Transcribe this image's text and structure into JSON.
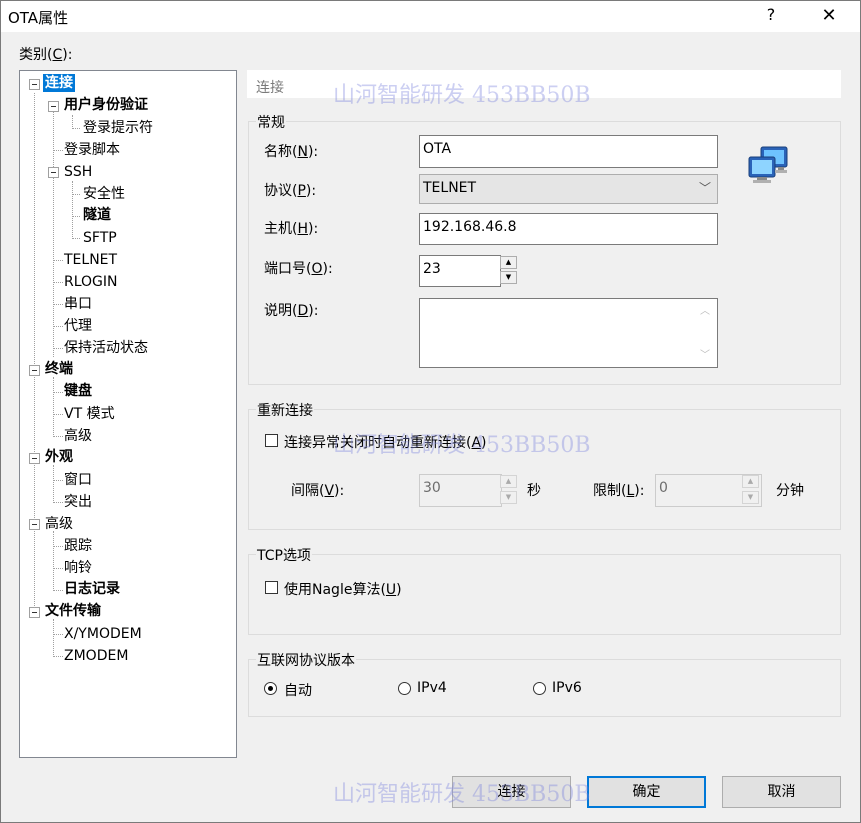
{
  "window": {
    "title": "OTA属性",
    "help": "?",
    "close": "✕"
  },
  "category_label": "类别(C):",
  "tree": [
    {
      "label": "连接",
      "selected": true
    },
    {
      "label": "用户身份验证"
    },
    {
      "label": "登录提示符"
    },
    {
      "label": "登录脚本"
    },
    {
      "label": "SSH"
    },
    {
      "label": "安全性"
    },
    {
      "label": "隧道"
    },
    {
      "label": "SFTP"
    },
    {
      "label": "TELNET"
    },
    {
      "label": "RLOGIN"
    },
    {
      "label": "串口"
    },
    {
      "label": "代理"
    },
    {
      "label": "保持活动状态"
    },
    {
      "label": "终端"
    },
    {
      "label": "键盘"
    },
    {
      "label": "VT 模式"
    },
    {
      "label": "高级"
    },
    {
      "label": "外观"
    },
    {
      "label": "窗口"
    },
    {
      "label": "突出"
    },
    {
      "label": "高级"
    },
    {
      "label": "跟踪"
    },
    {
      "label": "响铃"
    },
    {
      "label": "日志记录"
    },
    {
      "label": "文件传输"
    },
    {
      "label": "X/YMODEM"
    },
    {
      "label": "ZMODEM"
    }
  ],
  "header": "连接",
  "general": {
    "title": "常规",
    "name_label_pre": "名称(",
    "name_key": "N",
    "name_label_post": "):",
    "name_value": "OTA",
    "protocol_label_pre": "协议(",
    "protocol_key": "P",
    "protocol_label_post": "):",
    "protocol_value": "TELNET",
    "host_label_pre": "主机(",
    "host_key": "H",
    "host_label_post": "):",
    "host_value": "192.168.46.8",
    "port_label_pre": "端口号(",
    "port_key": "O",
    "port_label_post": "):",
    "port_value": "23",
    "desc_label_pre": "说明(",
    "desc_key": "D",
    "desc_label_post": "):",
    "desc_value": ""
  },
  "reconnect": {
    "title": "重新连接",
    "checkbox_pre": "连接异常关闭时自动重新连接(",
    "checkbox_key": "A",
    "checkbox_post": ")",
    "interval_pre": "间隔(",
    "interval_key": "V",
    "interval_post": "):",
    "interval_value": "30",
    "seconds": "秒",
    "limit_pre": "限制(",
    "limit_key": "L",
    "limit_post": "):",
    "limit_value": "0",
    "minutes": "分钟"
  },
  "tcp": {
    "title": "TCP选项",
    "nagle_pre": "使用Nagle算法(",
    "nagle_key": "U",
    "nagle_post": ")"
  },
  "ip": {
    "title": "互联网协议版本",
    "auto": "自动",
    "ipv4": "IPv4",
    "ipv6": "IPv6"
  },
  "buttons": {
    "connect": "连接",
    "ok": "确定",
    "cancel": "取消"
  },
  "watermark": "山河智能研发 453BB50B",
  "icon_names": {
    "network": "network-computers-icon"
  }
}
